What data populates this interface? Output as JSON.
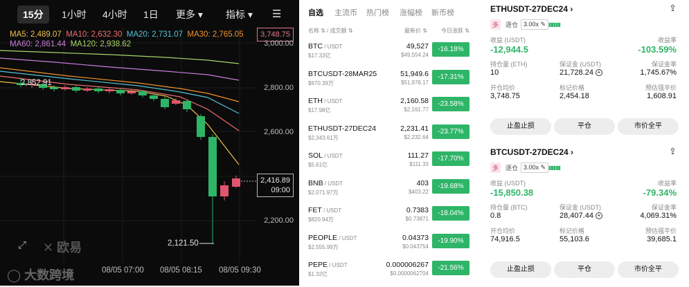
{
  "chart": {
    "tabs": [
      "15分",
      "1小时",
      "4小时",
      "1日",
      "更多 ▾",
      "指标 ▾"
    ],
    "ma_row1": [
      {
        "label": "MA5: 2,489.07",
        "color": "#f2c14e"
      },
      {
        "label": "MA10: 2,632.30",
        "color": "#ef6e6e"
      },
      {
        "label": "MA20: 2,731.07",
        "color": "#55c3d6"
      },
      {
        "label": "MA30: 2,765.05",
        "color": "#f0922b"
      }
    ],
    "ma_row2": [
      {
        "label": "MA60: 2,861.44",
        "color": "#c77ddc"
      },
      {
        "label": "MA120: 2,938.62",
        "color": "#a7d66a"
      }
    ],
    "last_price": "3,748.75",
    "yaxis": [
      "3,000.00",
      "2,800.00",
      "2,600.00",
      "2,200.00"
    ],
    "current_price": "2,416.89",
    "countdown": "09:00",
    "high_label": "2,852.91",
    "low_label": "2,121.50",
    "xaxis": [
      "08/05 07:00",
      "08/05 08:15",
      "08/05 09:30"
    ],
    "watermark": "欧易",
    "watermark2": "大数跨境"
  },
  "list": {
    "tabs": [
      "自选",
      "主流币",
      "热门榜",
      "涨幅榜",
      "新币榜"
    ],
    "headers": {
      "name": "名称 ⇅ / 成交额 ⇅",
      "price": "最新价 ⇅",
      "change": "今日涨跌 ⇅"
    },
    "rows": [
      {
        "sym": "BTC",
        "quote": " / USDT",
        "vol": "$17.33亿",
        "last": "49,527",
        "last_usd": "$49,554.24",
        "chg": "-16.18%"
      },
      {
        "sym": "BTCUSDT-28MAR25",
        "quote": "",
        "vol": "$970.39万",
        "last": "51,949.6",
        "last_usd": "$51,978.17",
        "chg": "-17.31%"
      },
      {
        "sym": "ETH",
        "quote": " / USDT",
        "vol": "$17.98亿",
        "last": "2,160.58",
        "last_usd": "$2,161.77",
        "chg": "-23.58%"
      },
      {
        "sym": "ETHUSDT-27DEC24",
        "quote": "",
        "vol": "$2,343.61万",
        "last": "2,231.41",
        "last_usd": "$2,232.64",
        "chg": "-23.77%"
      },
      {
        "sym": "SOL",
        "quote": " / USDT",
        "vol": "$5.61亿",
        "last": "111.27",
        "last_usd": "$111.33",
        "chg": "-17.70%"
      },
      {
        "sym": "BNB",
        "quote": " / USDT",
        "vol": "$2,071.97万",
        "last": "403",
        "last_usd": "$403.22",
        "chg": "-19.68%"
      },
      {
        "sym": "FET",
        "quote": " / USDT",
        "vol": "$820.94万",
        "last": "0.7383",
        "last_usd": "$0.73871",
        "chg": "-18.04%"
      },
      {
        "sym": "PEOPLE",
        "quote": " / USDT",
        "vol": "$2,555.99万",
        "last": "0.04373",
        "last_usd": "$0.043754",
        "chg": "-19.90%"
      },
      {
        "sym": "PEPE",
        "quote": " / USDT",
        "vol": "$1.32亿",
        "last": "0.000006267",
        "last_usd": "$0.0000062704",
        "chg": "-21.56%"
      }
    ]
  },
  "positions": [
    {
      "title": "ETHUSDT-27DEC24 ›",
      "side": "多",
      "mode": "逐仓",
      "leverage": "3.00x ✎",
      "pnl_label": "收益 (USDT)",
      "pnl": "-12,944.5",
      "roe_label": "收益率",
      "roe": "-103.59%",
      "qty_label": "持仓量 (ETH)",
      "qty": "10",
      "margin_label": "保证金 (USDT)",
      "margin": "21,728.24",
      "mratio_label": "保证金率",
      "mratio": "1,745.67%",
      "entry_label": "开仓均价",
      "entry": "3,748.75",
      "mark_label": "标记价格",
      "mark": "2,454.18",
      "liq_label": "预估强平价",
      "liq": "1,608.91",
      "buttons": [
        "止盈止损",
        "平仓",
        "市价全平"
      ]
    },
    {
      "title": "BTCUSDT-27DEC24 ›",
      "side": "多",
      "mode": "逐仓",
      "leverage": "3.00x ✎",
      "pnl_label": "收益 (USDT)",
      "pnl": "-15,850.38",
      "roe_label": "收益率",
      "roe": "-79.34%",
      "qty_label": "持仓量 (BTC)",
      "qty": "0.8",
      "margin_label": "保证金 (USDT)",
      "margin": "28,407.44",
      "mratio_label": "保证金率",
      "mratio": "4,069.31%",
      "entry_label": "开仓均价",
      "entry": "74,916.5",
      "mark_label": "标记价格",
      "mark": "55,103.6",
      "liq_label": "预估强平价",
      "liq": "39,685.1",
      "buttons": [
        "止盈止损",
        "平仓",
        "市价全平"
      ]
    }
  ]
}
